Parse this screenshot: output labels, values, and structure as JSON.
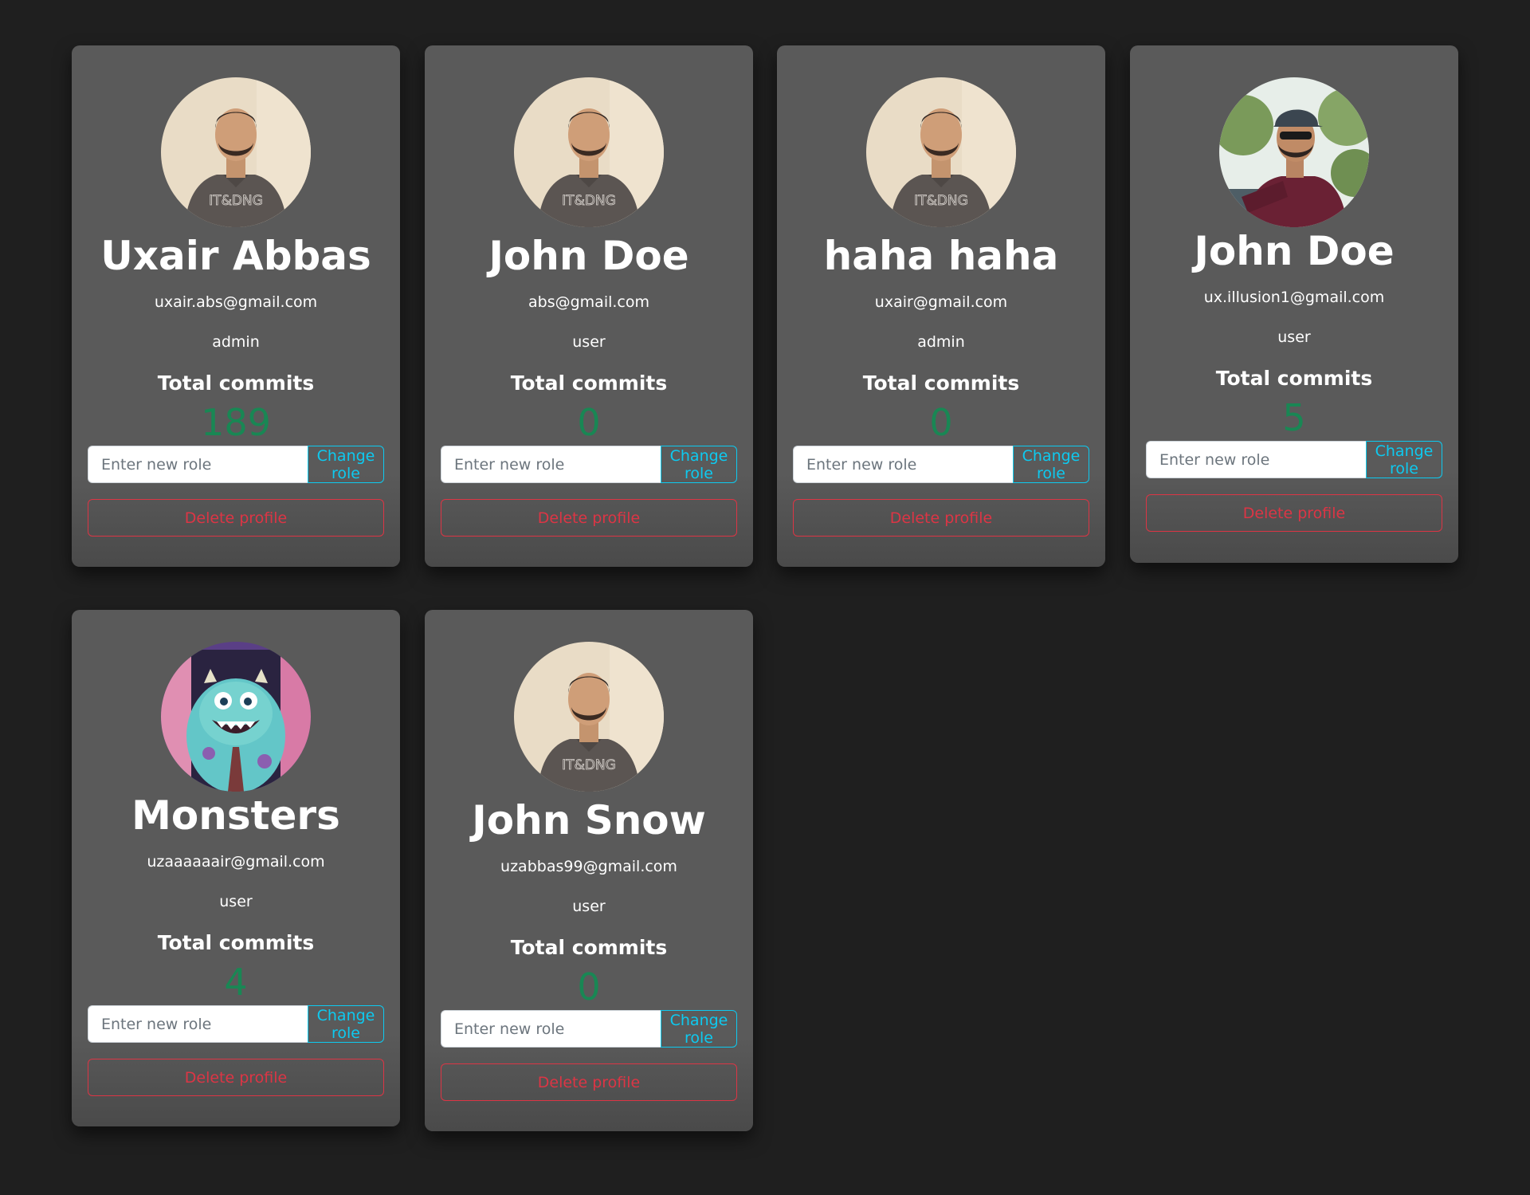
{
  "users": [
    {
      "name": "Uxair Abbas",
      "email": "uxair.abs@gmail.com",
      "role": "admin",
      "commits_label": "Total commits",
      "commits": "189",
      "input_placeholder": "Enter new role",
      "change_label": "Change role",
      "delete_label": "Delete profile",
      "avatar": "profile-photo-gray-tshirt"
    },
    {
      "name": "John Doe",
      "email": "abs@gmail.com",
      "role": "user",
      "commits_label": "Total commits",
      "commits": "0",
      "input_placeholder": "Enter new role",
      "change_label": "Change role",
      "delete_label": "Delete profile",
      "avatar": "profile-photo-gray-tshirt"
    },
    {
      "name": "haha haha",
      "email": "uxair@gmail.com",
      "role": "admin",
      "commits_label": "Total commits",
      "commits": "0",
      "input_placeholder": "Enter new role",
      "change_label": "Change role",
      "delete_label": "Delete profile",
      "avatar": "profile-photo-gray-tshirt"
    },
    {
      "name": "John Doe",
      "email": "ux.illusion1@gmail.com",
      "role": "user",
      "commits_label": "Total commits",
      "commits": "5",
      "input_placeholder": "Enter new role",
      "change_label": "Change role",
      "delete_label": "Delete profile",
      "avatar": "profile-photo-maroon-shirt-cap"
    },
    {
      "name": "Monsters",
      "email": "uzaaaaaair@gmail.com",
      "role": "user",
      "commits_label": "Total commits",
      "commits": "4",
      "input_placeholder": "Enter new role",
      "change_label": "Change role",
      "delete_label": "Delete profile",
      "avatar": "monster-avatar-blue"
    },
    {
      "name": "John Snow",
      "email": "uzabbas99@gmail.com",
      "role": "user",
      "commits_label": "Total commits",
      "commits": "0",
      "input_placeholder": "Enter new role",
      "change_label": "Change role",
      "delete_label": "Delete profile",
      "avatar": "profile-photo-gray-tshirt"
    }
  ],
  "colors": {
    "page_background": "#1f1f1f",
    "card_background": "#5a5a5a",
    "commits_green": "#198754",
    "info_cyan": "#0dcaf0",
    "danger_red": "#dc3545"
  }
}
